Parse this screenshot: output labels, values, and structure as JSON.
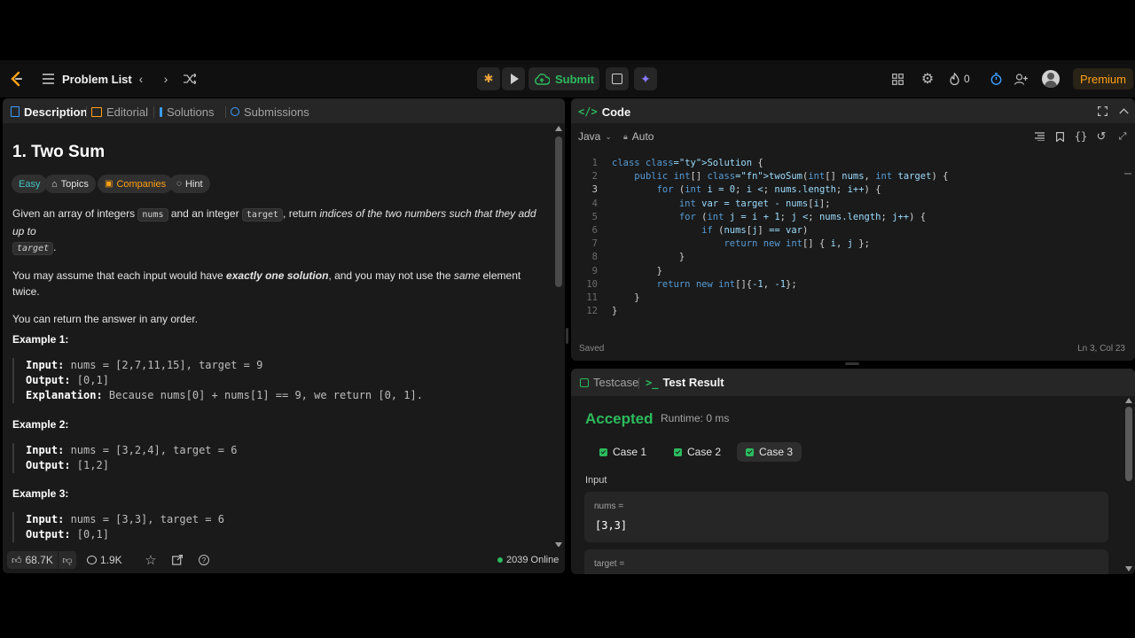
{
  "topbar": {
    "problem_list": "Problem List",
    "submit": "Submit",
    "streak_count": "0",
    "premium": "Premium"
  },
  "left": {
    "tabs": [
      "Description",
      "Editorial",
      "Solutions",
      "Submissions"
    ],
    "title": "1. Two Sum",
    "tags": [
      "Easy",
      "Topics",
      "Companies",
      "Hint"
    ],
    "desc": {
      "p1_a": "Given an array of integers ",
      "p1_code1": "nums",
      "p1_b": " and an integer ",
      "p1_code2": "target",
      "p1_c": ", return ",
      "p1_em": "indices of the two numbers such that they add up to",
      "p1_code3": "target",
      "p1_d": ".",
      "p2_a": "You may assume that each input would have ",
      "p2_strong": "exactly one solution",
      "p2_b": ", and you may not use the ",
      "p2_em": "same",
      "p2_c": " element twice.",
      "p3": "You can return the answer in any order."
    },
    "examples": [
      {
        "title": "Example 1:",
        "input_label": "Input:",
        "input": " nums = [2,7,11,15], target = 9",
        "output_label": "Output:",
        "output": " [0,1]",
        "expl_label": "Explanation:",
        "expl": " Because nums[0] + nums[1] == 9, we return [0, 1]."
      },
      {
        "title": "Example 2:",
        "input_label": "Input:",
        "input": " nums = [3,2,4], target = 6",
        "output_label": "Output:",
        "output": " [1,2]"
      },
      {
        "title": "Example 3:",
        "input_label": "Input:",
        "input": " nums = [3,3], target = 6",
        "output_label": "Output:",
        "output": " [0,1]"
      }
    ],
    "footer": {
      "likes": "68.7K",
      "comments": "1.9K",
      "online": "2039 Online"
    }
  },
  "code": {
    "tab": "Code",
    "language": "Java",
    "mode": "Auto",
    "lines": [
      "class Solution {",
      "    public int[] twoSum(int[] nums, int target) {",
      "        for (int i = 0; i < nums.length; i++) {",
      "            int var = target - nums[i];",
      "            for (int j = i + 1; j < nums.length; j++) {",
      "                if (nums[j] == var)",
      "                    return new int[] { i, j };",
      "            }",
      "        }",
      "        return new int[]{-1, -1};",
      "    }",
      "}"
    ],
    "status": "Saved",
    "cursor": "Ln 3, Col 23"
  },
  "result": {
    "tabs": [
      "Testcase",
      "Test Result"
    ],
    "verdict": "Accepted",
    "runtime": "Runtime: 0 ms",
    "cases": [
      "Case 1",
      "Case 2",
      "Case 3"
    ],
    "input_label": "Input",
    "var1_label": "nums =",
    "var1_value": "[3,3]",
    "var2_label": "target ="
  },
  "colors": {
    "accent_green": "#2cbb5d",
    "easy": "#46c6c2",
    "premium": "#ffa116"
  }
}
